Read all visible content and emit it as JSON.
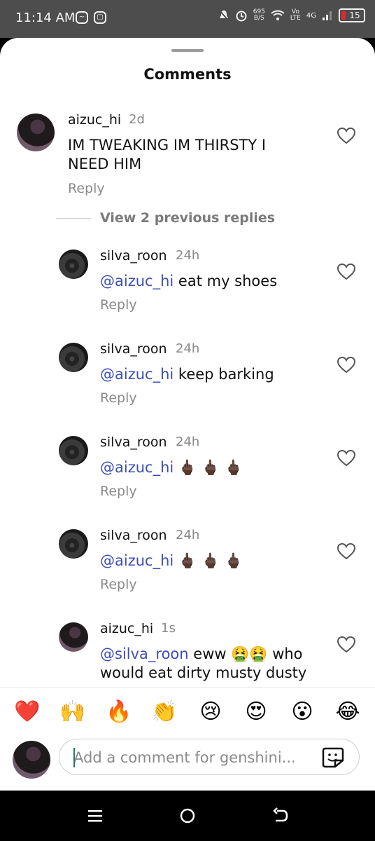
{
  "status_bar": {
    "time": "11:14 AM",
    "speed_top": "695",
    "speed_bottom": "B/S",
    "volte_top": "Vo",
    "volte_bottom": "LTE",
    "network": "4G",
    "battery": "15",
    "battery_color": "#e0282e"
  },
  "sheet": {
    "title": "Comments"
  },
  "comments": [
    {
      "username": "aizuc_hi",
      "time": "2d",
      "text_line1": "IM TWEAKING IM THIRSTY I",
      "text_line2": "NEED HIM",
      "reply": "Reply"
    }
  ],
  "view_previous": "View 2 previous replies",
  "replies": [
    {
      "username": "silva_roon",
      "time": "24h",
      "mention": "@aizuc_hi",
      "text": "eat my shoes",
      "reply": "Reply"
    },
    {
      "username": "silva_roon",
      "time": "24h",
      "mention": "@aizuc_hi",
      "text": "keep barking",
      "reply": "Reply"
    },
    {
      "username": "silva_roon",
      "time": "24h",
      "mention": "@aizuc_hi",
      "text": "🖕🏿 🖕🏿 🖕🏿",
      "reply": "Reply"
    },
    {
      "username": "silva_roon",
      "time": "24h",
      "mention": "@aizuc_hi",
      "text": "🖕🏿 🖕🏿 🖕🏿",
      "reply": "Reply"
    },
    {
      "username": "aizuc_hi",
      "time": "1s",
      "mention": "@silva_roon",
      "text": "eww 🤮🤮 who",
      "text_line2": "would eat dirty musty dusty"
    }
  ],
  "emoji_bar": [
    "❤️",
    "🙌",
    "🔥",
    "👏",
    "😢",
    "😍",
    "😮",
    "😂"
  ],
  "composer": {
    "placeholder": "Add a comment for genshini..."
  },
  "colors": {
    "mention": "#3d4fb5",
    "heart": "#e02424"
  }
}
